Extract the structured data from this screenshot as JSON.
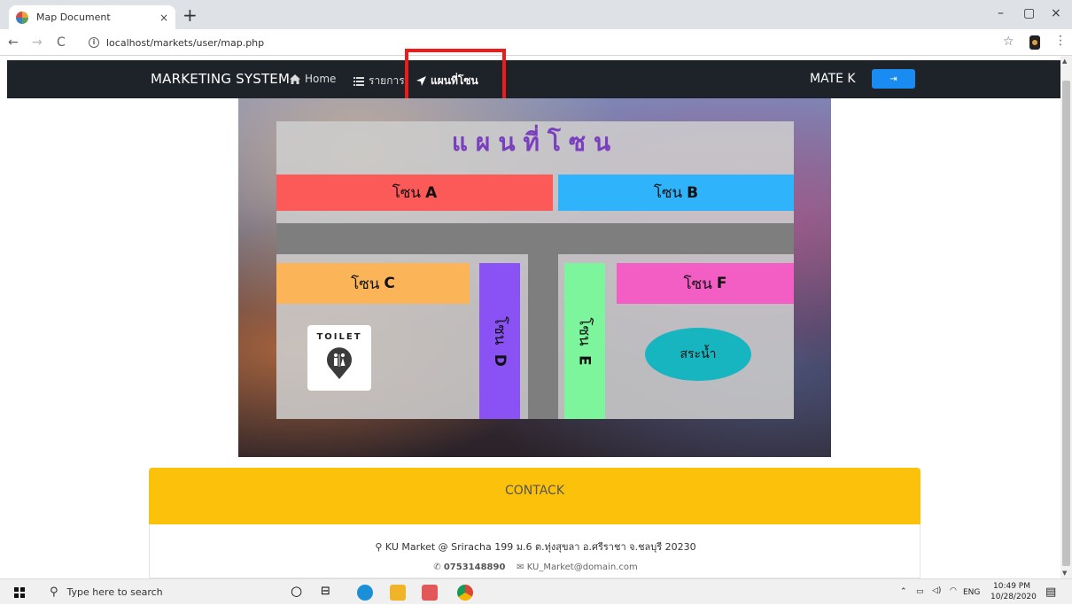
{
  "browser": {
    "tab_title": "Map Document",
    "tab_close": "×",
    "new_tab": "+",
    "url": "localhost/markets/user/map.php",
    "minimize": "–",
    "maximize": "▢",
    "close": "×"
  },
  "navbar": {
    "brand": "MARKETING SYSTEM",
    "items": [
      {
        "icon": "home-icon",
        "label": "Home"
      },
      {
        "icon": "list-icon",
        "label": "รายการ"
      },
      {
        "icon": "location-arrow-icon",
        "label": "แผนที่โซน"
      }
    ],
    "user": "MATE K",
    "logout_glyph": "⇥"
  },
  "map": {
    "title": "แผนที่โซน",
    "zones": [
      {
        "prefix": "โซน",
        "letter": "A",
        "color": "#fb5a58"
      },
      {
        "prefix": "โซน",
        "letter": "B",
        "color": "#2fb4fb"
      },
      {
        "prefix": "โซน",
        "letter": "C",
        "color": "#fbb558"
      },
      {
        "prefix": "โซน",
        "letter": "D",
        "color": "#8a52f5"
      },
      {
        "prefix": "โซน",
        "letter": "E",
        "color": "#7cf59c"
      },
      {
        "prefix": "โซน",
        "letter": "F",
        "color": "#f25ec4"
      }
    ],
    "toilet_label": "TOILET",
    "pond_label": "สระน้ำ"
  },
  "contact": {
    "heading": "CONTACK",
    "address": "KU Market @ Sriracha 199 ม.6 ต.ทุ่งสุขลา อ.ศรีราชา จ.ชลบุรี 20230",
    "phone": "0753148890",
    "email": "KU_Market@domain.com"
  },
  "taskbar": {
    "search_placeholder": "Type here to search",
    "lang": "ENG",
    "time": "10:49 PM",
    "date": "10/28/2020"
  }
}
